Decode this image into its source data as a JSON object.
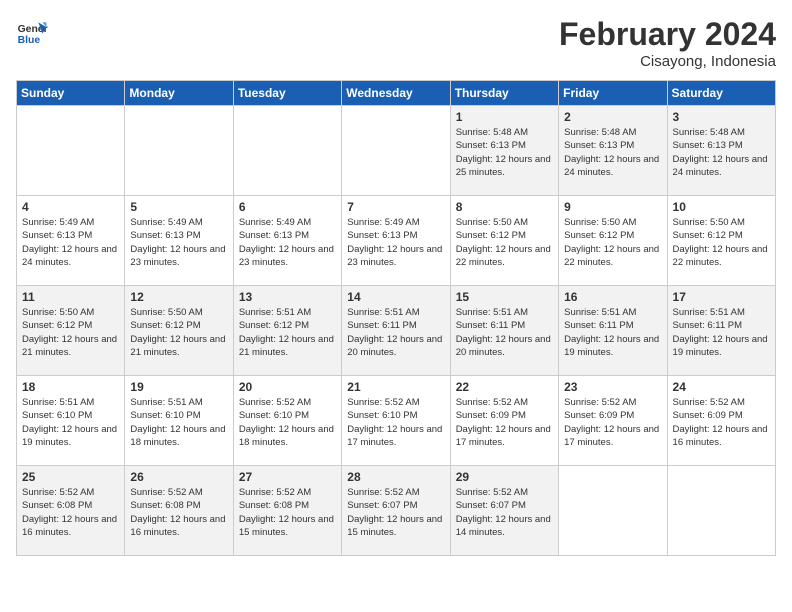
{
  "header": {
    "logo_line1": "General",
    "logo_line2": "Blue",
    "month_year": "February 2024",
    "location": "Cisayong, Indonesia"
  },
  "days_of_week": [
    "Sunday",
    "Monday",
    "Tuesday",
    "Wednesday",
    "Thursday",
    "Friday",
    "Saturday"
  ],
  "weeks": [
    [
      {
        "day": "",
        "info": ""
      },
      {
        "day": "",
        "info": ""
      },
      {
        "day": "",
        "info": ""
      },
      {
        "day": "",
        "info": ""
      },
      {
        "day": "1",
        "info": "Sunrise: 5:48 AM\nSunset: 6:13 PM\nDaylight: 12 hours\nand 25 minutes."
      },
      {
        "day": "2",
        "info": "Sunrise: 5:48 AM\nSunset: 6:13 PM\nDaylight: 12 hours\nand 24 minutes."
      },
      {
        "day": "3",
        "info": "Sunrise: 5:48 AM\nSunset: 6:13 PM\nDaylight: 12 hours\nand 24 minutes."
      }
    ],
    [
      {
        "day": "4",
        "info": "Sunrise: 5:49 AM\nSunset: 6:13 PM\nDaylight: 12 hours\nand 24 minutes."
      },
      {
        "day": "5",
        "info": "Sunrise: 5:49 AM\nSunset: 6:13 PM\nDaylight: 12 hours\nand 23 minutes."
      },
      {
        "day": "6",
        "info": "Sunrise: 5:49 AM\nSunset: 6:13 PM\nDaylight: 12 hours\nand 23 minutes."
      },
      {
        "day": "7",
        "info": "Sunrise: 5:49 AM\nSunset: 6:13 PM\nDaylight: 12 hours\nand 23 minutes."
      },
      {
        "day": "8",
        "info": "Sunrise: 5:50 AM\nSunset: 6:12 PM\nDaylight: 12 hours\nand 22 minutes."
      },
      {
        "day": "9",
        "info": "Sunrise: 5:50 AM\nSunset: 6:12 PM\nDaylight: 12 hours\nand 22 minutes."
      },
      {
        "day": "10",
        "info": "Sunrise: 5:50 AM\nSunset: 6:12 PM\nDaylight: 12 hours\nand 22 minutes."
      }
    ],
    [
      {
        "day": "11",
        "info": "Sunrise: 5:50 AM\nSunset: 6:12 PM\nDaylight: 12 hours\nand 21 minutes."
      },
      {
        "day": "12",
        "info": "Sunrise: 5:50 AM\nSunset: 6:12 PM\nDaylight: 12 hours\nand 21 minutes."
      },
      {
        "day": "13",
        "info": "Sunrise: 5:51 AM\nSunset: 6:12 PM\nDaylight: 12 hours\nand 21 minutes."
      },
      {
        "day": "14",
        "info": "Sunrise: 5:51 AM\nSunset: 6:11 PM\nDaylight: 12 hours\nand 20 minutes."
      },
      {
        "day": "15",
        "info": "Sunrise: 5:51 AM\nSunset: 6:11 PM\nDaylight: 12 hours\nand 20 minutes."
      },
      {
        "day": "16",
        "info": "Sunrise: 5:51 AM\nSunset: 6:11 PM\nDaylight: 12 hours\nand 19 minutes."
      },
      {
        "day": "17",
        "info": "Sunrise: 5:51 AM\nSunset: 6:11 PM\nDaylight: 12 hours\nand 19 minutes."
      }
    ],
    [
      {
        "day": "18",
        "info": "Sunrise: 5:51 AM\nSunset: 6:10 PM\nDaylight: 12 hours\nand 19 minutes."
      },
      {
        "day": "19",
        "info": "Sunrise: 5:51 AM\nSunset: 6:10 PM\nDaylight: 12 hours\nand 18 minutes."
      },
      {
        "day": "20",
        "info": "Sunrise: 5:52 AM\nSunset: 6:10 PM\nDaylight: 12 hours\nand 18 minutes."
      },
      {
        "day": "21",
        "info": "Sunrise: 5:52 AM\nSunset: 6:10 PM\nDaylight: 12 hours\nand 17 minutes."
      },
      {
        "day": "22",
        "info": "Sunrise: 5:52 AM\nSunset: 6:09 PM\nDaylight: 12 hours\nand 17 minutes."
      },
      {
        "day": "23",
        "info": "Sunrise: 5:52 AM\nSunset: 6:09 PM\nDaylight: 12 hours\nand 17 minutes."
      },
      {
        "day": "24",
        "info": "Sunrise: 5:52 AM\nSunset: 6:09 PM\nDaylight: 12 hours\nand 16 minutes."
      }
    ],
    [
      {
        "day": "25",
        "info": "Sunrise: 5:52 AM\nSunset: 6:08 PM\nDaylight: 12 hours\nand 16 minutes."
      },
      {
        "day": "26",
        "info": "Sunrise: 5:52 AM\nSunset: 6:08 PM\nDaylight: 12 hours\nand 16 minutes."
      },
      {
        "day": "27",
        "info": "Sunrise: 5:52 AM\nSunset: 6:08 PM\nDaylight: 12 hours\nand 15 minutes."
      },
      {
        "day": "28",
        "info": "Sunrise: 5:52 AM\nSunset: 6:07 PM\nDaylight: 12 hours\nand 15 minutes."
      },
      {
        "day": "29",
        "info": "Sunrise: 5:52 AM\nSunset: 6:07 PM\nDaylight: 12 hours\nand 14 minutes."
      },
      {
        "day": "",
        "info": ""
      },
      {
        "day": "",
        "info": ""
      }
    ]
  ]
}
